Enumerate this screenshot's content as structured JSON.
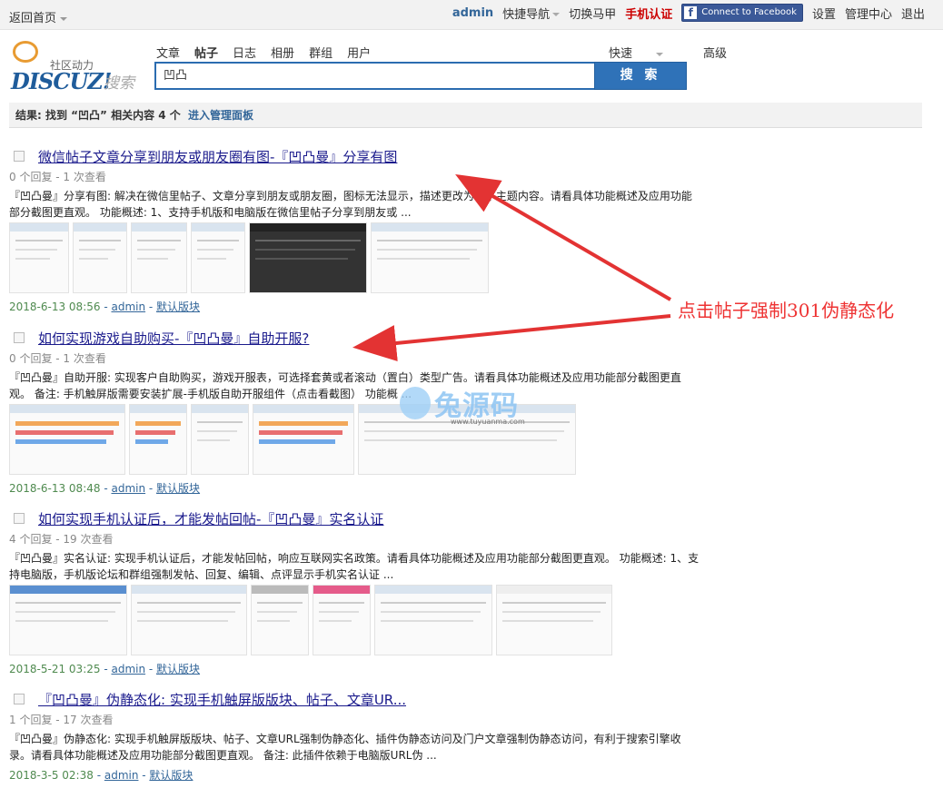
{
  "topbar": {
    "back_home": "返回首页",
    "username": "admin",
    "quick_nav": "快捷导航",
    "switch_vest": "切换马甲",
    "phone_verify": "手机认证",
    "facebook": "Connect to Facebook",
    "settings": "设置",
    "admin_center": "管理中心",
    "logout": "退出"
  },
  "logo": {
    "community": "社区动力",
    "brand": "DISCUZ!",
    "search_word": "搜索"
  },
  "search": {
    "tabs": [
      "文章",
      "帖子",
      "日志",
      "相册",
      "群组",
      "用户"
    ],
    "active_tab": "帖子",
    "quick": "快速",
    "advanced": "高级",
    "query": "凹凸",
    "button": "搜 索"
  },
  "result": {
    "prefix": "结果: 找到 “凹凸” 相关内容 4 个",
    "admin_link": "进入管理面板"
  },
  "posts": [
    {
      "title": "微信帖子文章分享到朋友或朋友圈有图-『凹凸曼』分享有图",
      "meta": "0 个回复 - 1 次查看",
      "desc": "『凹凸曼』分享有图: 解决在微信里帖子、文章分享到朋友或朋友圈，图标无法显示，描述更改为帖子主题内容。请看具体功能概述及应用功能部分截图更直观。 功能概述: 1、支持手机版和电脑版在微信里帖子分享到朋友或 ...",
      "date": "2018-6-13 08:56",
      "author": "admin",
      "forum": "默认版块"
    },
    {
      "title": "如何实现游戏自助购买-『凹凸曼』自助开服?",
      "meta": "0 个回复 - 1 次查看",
      "desc": "『凹凸曼』自助开服: 实现客户自助购买，游戏开服表，可选择套黄或者滚动（置白）类型广告。请看具体功能概述及应用功能部分截图更直观。 备注: 手机触屏版需要安装扩展-手机版自助开服组件（点击看截图） 功能概 ...",
      "date": "2018-6-13 08:48",
      "author": "admin",
      "forum": "默认版块"
    },
    {
      "title": "如何实现手机认证后，才能发帖回帖-『凹凸曼』实名认证",
      "meta": "4 个回复 - 19 次查看",
      "desc": "『凹凸曼』实名认证: 实现手机认证后，才能发帖回帖，响应互联网实名政策。请看具体功能概述及应用功能部分截图更直观。 功能概述: 1、支持电脑版，手机版论坛和群组强制发帖、回复、编辑、点评显示手机实名认证 ...",
      "date": "2018-5-21 03:25",
      "author": "admin",
      "forum": "默认版块"
    },
    {
      "title": "『凹凸曼』伪静态化: 实现手机触屏版版块、帖子、文章UR...",
      "meta": "1 个回复 - 17 次查看",
      "desc": "『凹凸曼』伪静态化: 实现手机触屏版版块、帖子、文章URL强制伪静态化、插件伪静态访问及门户文章强制伪静态访问，有利于搜索引擎收录。请看具体功能概述及应用功能部分截图更直观。 备注: 此插件依赖于电脑版URL伪 ...",
      "date": "2018-3-5 02:38",
      "author": "admin",
      "forum": "默认版块"
    }
  ],
  "annotation": "点击帖子强制301伪静态化",
  "watermark": {
    "text": "兔源码",
    "url": "www.tuyuanma.com"
  },
  "colors": {
    "accent": "#2f72b8",
    "link": "#1a1a8c",
    "annotation": "#e33333"
  }
}
